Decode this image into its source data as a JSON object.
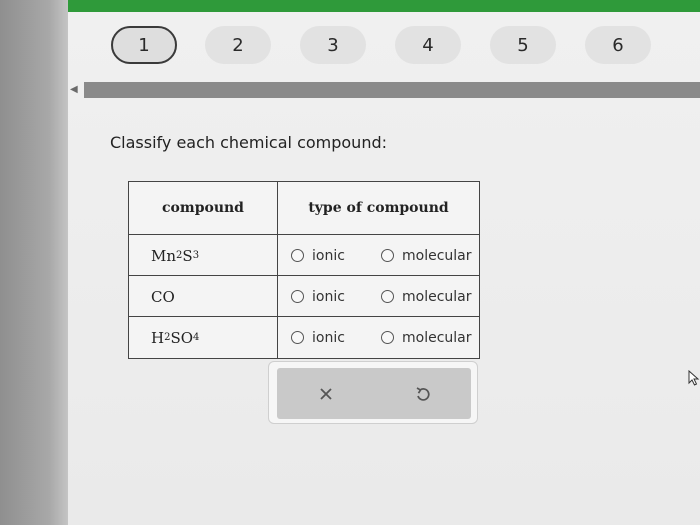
{
  "steps": [
    "1",
    "2",
    "3",
    "4",
    "5",
    "6"
  ],
  "active_step": "1",
  "question": "Classify each chemical compound:",
  "table": {
    "headers": {
      "compound": "compound",
      "type": "type of compound"
    },
    "rows": [
      {
        "formula": [
          {
            "t": "Mn"
          },
          {
            "sub": "2"
          },
          {
            "t": "S"
          },
          {
            "sub": "3"
          }
        ],
        "options": [
          "ionic",
          "molecular"
        ]
      },
      {
        "formula": [
          {
            "t": "CO"
          }
        ],
        "options": [
          "ionic",
          "molecular"
        ]
      },
      {
        "formula": [
          {
            "t": "H"
          },
          {
            "sub": "2"
          },
          {
            "t": "SO"
          },
          {
            "sub": "4"
          }
        ],
        "options": [
          "ionic",
          "molecular"
        ]
      }
    ]
  },
  "tools": {
    "clear_icon": "x-icon",
    "undo_icon": "undo-icon"
  },
  "colors": {
    "accent_green": "#2f9a3a",
    "progress_track": "#8a8a8a"
  }
}
